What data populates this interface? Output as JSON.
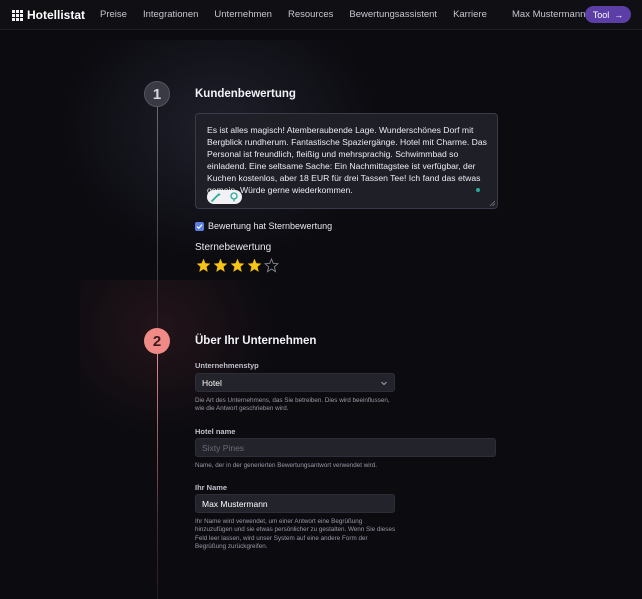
{
  "nav": {
    "brand": "Hotellistat",
    "links": [
      "Preise",
      "Integrationen",
      "Unternehmen",
      "Resources",
      "Bewertungsassistent",
      "Karriere"
    ],
    "user": "Max Mustermann",
    "tool_label": "Tool"
  },
  "step1": {
    "number": "1",
    "title": "Kundenbewertung",
    "review_text": "Es ist alles magisch! Atemberaubende Lage. Wunderschönes Dorf mit Bergblick rundherum. Fantastische Spaziergänge. Hotel mit Charme. Das Personal ist freundlich, fleißig und mehrsprachig. Schwimmbad so einladend. Eine seltsame Sache: Ein Nachmittagstee ist verfügbar, der Kuchen kostenlos, aber 18 EUR für drei Tassen Tee! Ich fand das etwas gemein. Würde gerne wiederkommen.",
    "has_stars_label": "Bewertung hat Sternbewertung",
    "has_stars_checked": true,
    "stars_label": "Sternebewertung",
    "rating": 4,
    "rating_max": 5
  },
  "step2": {
    "number": "2",
    "title": "Über Ihr Unternehmen",
    "business_type_label": "Unternehmenstyp",
    "business_type_value": "Hotel",
    "business_type_help": "Die Art des Unternehmens, das Sie betreiben. Dies wird beeinflussen, wie die Antwort geschrieben wird.",
    "hotel_name_label": "Hotel name",
    "hotel_name_placeholder": "Sixty Pines",
    "hotel_name_help": "Name, der in der generierten Bewertungsantwort verwendet wird.",
    "your_name_label": "Ihr Name",
    "your_name_value": "Max Mustermann",
    "your_name_help": "Ihr Name wird verwendet, um einer Antwort eine Begrüßung hinzuzufügen und sie etwas persönlicher zu gestalten. Wenn Sie dieses Feld leer lassen, wird unser System auf eine andere Form der Begrüßung zurückgreifen."
  },
  "colors": {
    "accent_purple": "#5b3fa6",
    "step2_accent": "#f08a87",
    "star_filled": "#f5c518",
    "checkbox": "#5b7fe0"
  }
}
